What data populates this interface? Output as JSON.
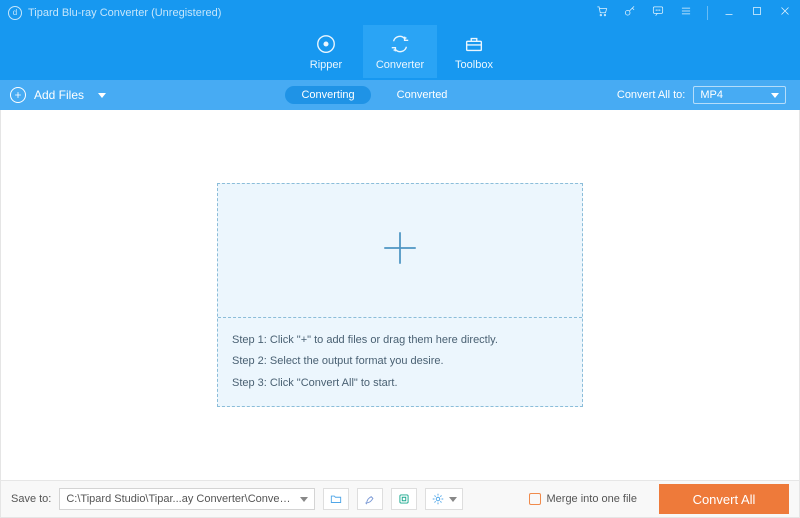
{
  "titlebar": {
    "appName": "Tipard Blu-ray Converter (Unregistered)",
    "icons": {
      "cart": "cart-icon",
      "key": "key-icon",
      "feedback": "feedback-icon",
      "menu": "menu-icon",
      "minimize": "minimize-icon",
      "maximize": "maximize-icon",
      "close": "close-icon"
    }
  },
  "nav": {
    "items": [
      {
        "label": "Ripper",
        "active": false,
        "icon": "ripper-icon"
      },
      {
        "label": "Converter",
        "active": true,
        "icon": "converter-icon"
      },
      {
        "label": "Toolbox",
        "active": false,
        "icon": "toolbox-icon"
      }
    ]
  },
  "subbar": {
    "addFiles": "Add Files",
    "tabs": {
      "converting": "Converting",
      "converted": "Converted",
      "active": "converting"
    },
    "convertAllLabel": "Convert All to:",
    "selectedFormat": "MP4"
  },
  "dropzone": {
    "step1": "Step 1: Click \"+\" to add files or drag them here directly.",
    "step2": "Step 2: Select the output format you desire.",
    "step3": "Step 3: Click \"Convert All\" to start."
  },
  "footer": {
    "saveToLabel": "Save to:",
    "savePath": "C:\\Tipard Studio\\Tipar...ay Converter\\Converted",
    "mergeLabel": "Merge into one file",
    "convertAllBtn": "Convert All",
    "tools": {
      "openFolder": "open-folder-icon",
      "edit": "edit-tool-icon",
      "compress": "compress-tool-icon",
      "settings": "settings-tool-icon"
    }
  },
  "colors": {
    "primary": "#1798f0",
    "accent": "#ee7a3a",
    "drop": "#ecf6fd"
  }
}
